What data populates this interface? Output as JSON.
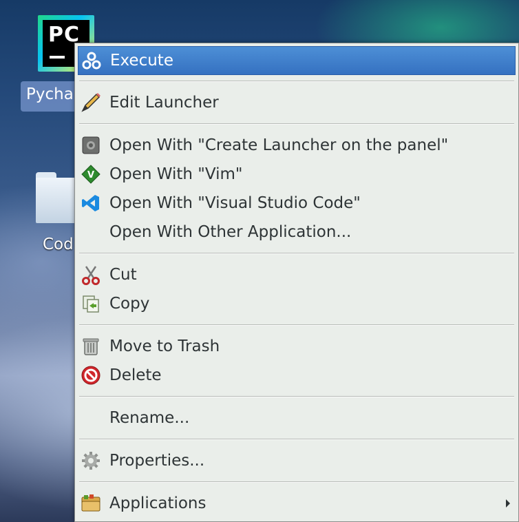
{
  "desktop": {
    "pycharm_icon_text": "PC",
    "pycharm_label": "Pycha",
    "folder_label": "Cod"
  },
  "menu": {
    "items": [
      {
        "label": "Execute",
        "icon": "execute-gears-icon"
      },
      {
        "label": "Edit Launcher",
        "icon": "pencil-icon"
      },
      {
        "label": "Open With \"Create Launcher on the panel\"",
        "icon": "launcher-app-icon"
      },
      {
        "label": "Open With \"Vim\"",
        "icon": "vim-icon"
      },
      {
        "label": "Open With \"Visual Studio Code\"",
        "icon": "vscode-icon"
      },
      {
        "label": "Open With Other Application...",
        "icon": ""
      },
      {
        "label": "Cut",
        "icon": "scissors-icon"
      },
      {
        "label": "Copy",
        "icon": "copy-icon"
      },
      {
        "label": "Move to Trash",
        "icon": "trash-icon"
      },
      {
        "label": "Delete",
        "icon": "delete-icon"
      },
      {
        "label": "Rename...",
        "icon": ""
      },
      {
        "label": "Properties...",
        "icon": "gear-icon"
      },
      {
        "label": "Applications",
        "icon": "applications-folder-icon"
      }
    ]
  },
  "colors": {
    "highlight": "#3a78c8",
    "menu_bg": "#eaeeea",
    "text": "#2e3436"
  }
}
